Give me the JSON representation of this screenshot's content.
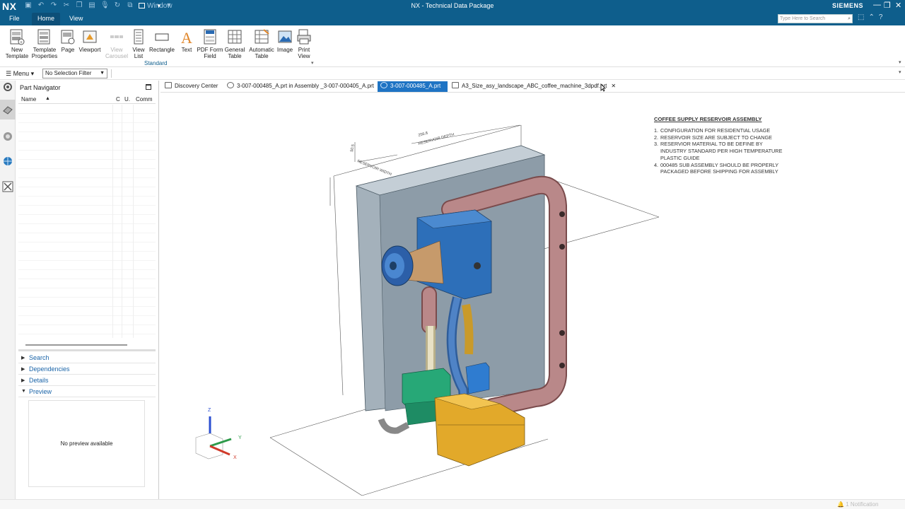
{
  "title_bar": {
    "logo": "NX",
    "window_menu": "Window",
    "app_title": "NX - Technical Data Package",
    "brand": "SIEMENS"
  },
  "menu_bar": {
    "tabs": [
      {
        "label": "File"
      },
      {
        "label": "Home"
      },
      {
        "label": "View"
      }
    ],
    "search_placeholder": "Type Here to Search"
  },
  "ribbon": {
    "buttons": [
      {
        "label": "New\nTemplate",
        "icon": "new-template-icon"
      },
      {
        "label": "Template\nProperties",
        "icon": "template-properties-icon"
      },
      {
        "label": "Page",
        "icon": "page-icon"
      },
      {
        "label": "Viewport",
        "icon": "viewport-icon"
      },
      {
        "label": "View\nCarousel",
        "icon": "view-carousel-icon",
        "disabled": true
      },
      {
        "label": "View\nList",
        "icon": "view-list-icon"
      },
      {
        "label": "Rectangle",
        "icon": "rectangle-icon"
      },
      {
        "label": "Text",
        "icon": "text-icon"
      },
      {
        "label": "PDF Form\nField",
        "icon": "pdf-form-field-icon"
      },
      {
        "label": "General\nTable",
        "icon": "general-table-icon"
      },
      {
        "label": "Automatic\nTable",
        "icon": "automatic-table-icon"
      },
      {
        "label": "Image",
        "icon": "image-icon"
      },
      {
        "label": "Print\nView",
        "icon": "print-view-icon"
      }
    ],
    "group_label": "Standard"
  },
  "toolbar": {
    "menu_label": "Menu",
    "selection_filter": "No Selection Filter"
  },
  "part_navigator": {
    "title": "Part Navigator",
    "columns": [
      "Name",
      "C",
      "U.",
      "Comm"
    ],
    "sections": [
      {
        "label": "Search",
        "expanded": false
      },
      {
        "label": "Dependencies",
        "expanded": false
      },
      {
        "label": "Details",
        "expanded": false
      },
      {
        "label": "Preview",
        "expanded": true
      }
    ],
    "preview_text": "No preview available"
  },
  "document_tabs": [
    {
      "label": "Discovery Center",
      "active": false
    },
    {
      "label": "3-007-000485_A.prt in Assembly _3-007-000405_A.prt",
      "active": false
    },
    {
      "label": "3-007-000485_A.prt",
      "active": true
    },
    {
      "label": "A3_Size_asy_landscape_ABC_coffee_machine_3dpdf.prt",
      "active": false
    }
  ],
  "drawing": {
    "notes_title": "COFFEE SUPPLY RESERVOIR ASSEMBLY",
    "notes": [
      {
        "num": "1.",
        "text": "CONFIGURATION FOR RESIDENTIAL USAGE"
      },
      {
        "num": "2.",
        "text": "RESERVOIR SIZE ARE SUBJECT TO CHANGE"
      },
      {
        "num": "3.",
        "text": "RESERVIOR MATERIAL TO BE DEFINE BY"
      },
      {
        "num": "",
        "text": "INDUSTRY STANDARD PER HIGH TEMPERATURE"
      },
      {
        "num": "",
        "text": "PLASTIC GUIDE"
      },
      {
        "num": "4.",
        "text": "000485 SUB ASSEMBLY SHOULD BE PROPERLY"
      },
      {
        "num": "",
        "text": "PACKAGED BEFORE SHIPPING FOR ASSEMBLY"
      }
    ],
    "dim_depth_value": "256.8",
    "dim_depth_label": "RESERVOIR DEPTH",
    "dim_width_value": "50.5",
    "dim_width_label": "RESERVOIR WIDTH",
    "axis_labels": {
      "z": "Z",
      "y": "Y",
      "x": "X"
    }
  },
  "status_bar": {
    "notification": "1 Notification"
  },
  "colors": {
    "title_bar": "#0e5e8c",
    "active_tab": "#1f74c4",
    "reservoir": "#9aa8b3",
    "block": "#2c6fb8",
    "pipe": "#b87f80",
    "base": "#e5ab2a",
    "fitting": "#2bb27c"
  }
}
